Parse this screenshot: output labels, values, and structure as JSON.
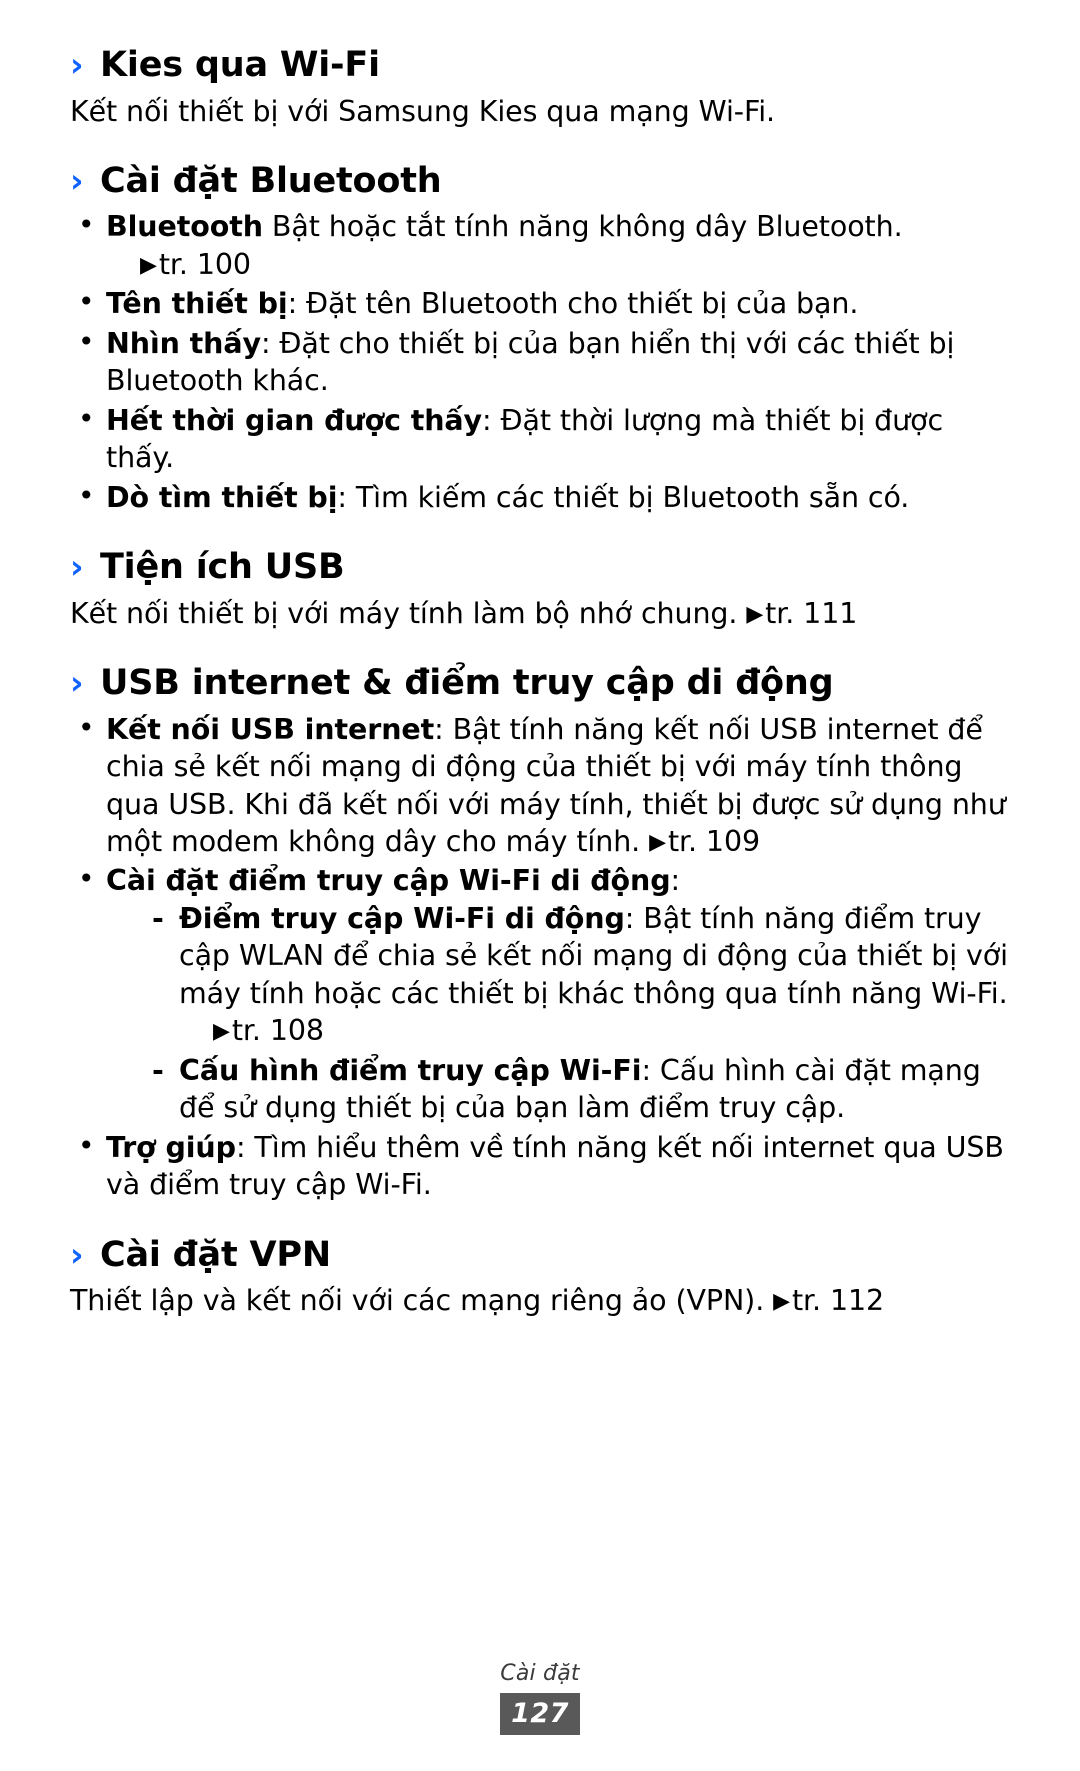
{
  "document": {
    "accent_color": "#0f62fe",
    "heading_marker": "›",
    "page_ref_marker": "▶",
    "bullet_marker": "•",
    "dash_marker": "-"
  },
  "sections": [
    {
      "id": "kies",
      "heading": "Kies qua Wi-Fi",
      "lead": "Kết nối thiết bị với Samsung Kies qua mạng Wi-Fi."
    },
    {
      "id": "bluetooth",
      "heading": "Cài đặt Bluetooth",
      "bullets": [
        {
          "term": "Bluetooth",
          "text": " Bật hoặc tắt tính năng không dây Bluetooth.",
          "pageref": "tr. 100",
          "pageref_own_line": true
        },
        {
          "term": "Tên thiết bị",
          "text": ": Đặt tên Bluetooth cho thiết bị của bạn."
        },
        {
          "term": "Nhìn thấy",
          "text": ": Đặt cho thiết bị của bạn hiển thị với các thiết bị Bluetooth khác."
        },
        {
          "term": "Hết thời gian được thấy",
          "text": ": Đặt thời lượng mà thiết bị được thấy."
        },
        {
          "term": "Dò tìm thiết bị",
          "text": ": Tìm kiếm các thiết bị Bluetooth sẵn có."
        }
      ]
    },
    {
      "id": "usb-utility",
      "heading": "Tiện ích USB",
      "lead": "Kết nối thiết bị với máy tính làm bộ nhớ chung.",
      "lead_pageref": "tr. 111"
    },
    {
      "id": "usb-internet",
      "heading": "USB internet & điểm truy cập di động",
      "bullets": [
        {
          "term": "Kết nối USB internet",
          "text": ": Bật tính năng kết nối USB internet để chia sẻ kết nối mạng di động của thiết bị với máy tính thông qua USB. Khi đã kết nối với máy tính, thiết bị được sử dụng như một modem không dây cho máy tính.",
          "pageref": "tr. 109",
          "pageref_inline": true
        },
        {
          "term": "Cài đặt điểm truy cập Wi-Fi di động",
          "text": ":",
          "sub": [
            {
              "term": "Điểm truy cập Wi-Fi di động",
              "text": ": Bật tính năng điểm truy cập WLAN để chia sẻ kết nối mạng di động của thiết bị với máy tính hoặc các thiết bị khác thông qua tính năng Wi-Fi.",
              "pageref": "tr. 108",
              "pageref_own_line": true
            },
            {
              "term": "Cấu hình điểm truy cập Wi-Fi",
              "text": ": Cấu hình cài đặt mạng để sử dụng thiết bị của bạn làm điểm truy cập."
            }
          ]
        },
        {
          "term": "Trợ giúp",
          "text": ": Tìm hiểu thêm về tính năng kết nối internet qua USB và điểm truy cập Wi-Fi."
        }
      ]
    },
    {
      "id": "vpn",
      "heading": "Cài đặt VPN",
      "lead": "Thiết lập và kết nối với các mạng riêng ảo (VPN).",
      "lead_pageref": "tr. 112"
    }
  ],
  "footer": {
    "chapter": "Cài đặt",
    "page_number": "127"
  }
}
